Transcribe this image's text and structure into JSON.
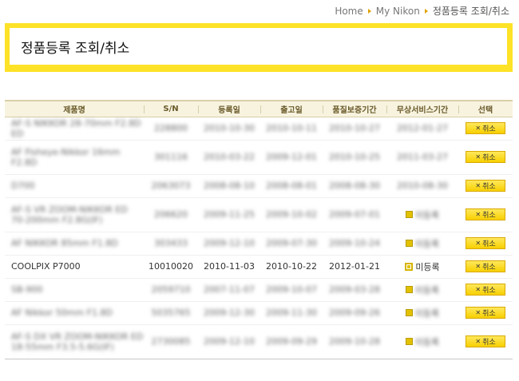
{
  "breadcrumb": [
    {
      "label": "Home"
    },
    {
      "label": "My Nikon"
    },
    {
      "label": "정품등록 조회/취소"
    }
  ],
  "page_title": "정품등록 조회/취소",
  "table": {
    "columns": [
      "제품명",
      "S/N",
      "등록일",
      "출고일",
      "품질보증기간",
      "무상서비스기간",
      "선택"
    ],
    "cancel_label": "취소",
    "rows": [
      {
        "name": "AF-S NIKKOR 28-70mm F2.8D ED",
        "sn": "228800",
        "reg": "2010-10-30",
        "ship": "2010-10-11",
        "warranty": "2010-10-27",
        "service": "2012-01-27",
        "service_kind": "date",
        "blurred": true
      },
      {
        "name": "AF Fisheye-Nikkor 16mm F2.8D",
        "sn": "301116",
        "reg": "2010-03-22",
        "ship": "2009-12-01",
        "warranty": "2010-10-25",
        "service": "2011-03-27",
        "service_kind": "date",
        "blurred": true
      },
      {
        "name": "D700",
        "sn": "2063073",
        "reg": "2008-08-10",
        "ship": "2008-08-01",
        "warranty": "2008-08-30",
        "service": "2010-08-30",
        "service_kind": "date",
        "blurred": true
      },
      {
        "name": "AF-S VR ZOOM-NIKKOR ED 70-200mm F2.8G(IF)",
        "sn": "206620",
        "reg": "2009-11-25",
        "ship": "2009-10-02",
        "warranty": "2009-07-01",
        "service": "미등록",
        "service_kind": "badge",
        "blurred": true
      },
      {
        "name": "AF NIKKOR 85mm F1.8D",
        "sn": "303433",
        "reg": "2009-12-10",
        "ship": "2009-07-30",
        "warranty": "2009-10-24",
        "service": "미등록",
        "service_kind": "badge",
        "blurred": true
      },
      {
        "name": "COOLPIX P7000",
        "sn": "10010020",
        "reg": "2010-11-03",
        "ship": "2010-10-22",
        "warranty": "2012-01-21",
        "service": "미등록",
        "service_kind": "badge-empty",
        "blurred": false
      },
      {
        "name": "SB-900",
        "sn": "2059710",
        "reg": "2007-11-07",
        "ship": "2009-10-07",
        "warranty": "2009-03-28",
        "service": "미등록",
        "service_kind": "badge",
        "blurred": true
      },
      {
        "name": "AF Nikkor 50mm F1.8D",
        "sn": "5035765",
        "reg": "2009-12-30",
        "ship": "2009-11-30",
        "warranty": "2009-09-26",
        "service": "미등록",
        "service_kind": "badge",
        "blurred": true
      },
      {
        "name": "AF-S DX VR ZOOM-NIKKOR ED 18-55mm F3.5-5.6G(IF)",
        "sn": "2730085",
        "reg": "2009-12-10",
        "ship": "2009-09-29",
        "warranty": "2009-10-28",
        "service": "미등록",
        "service_kind": "badge",
        "blurred": true
      }
    ]
  },
  "colors": {
    "accent": "#fde227",
    "button": "#f7cf00",
    "header_bg": "#f7f3df"
  }
}
